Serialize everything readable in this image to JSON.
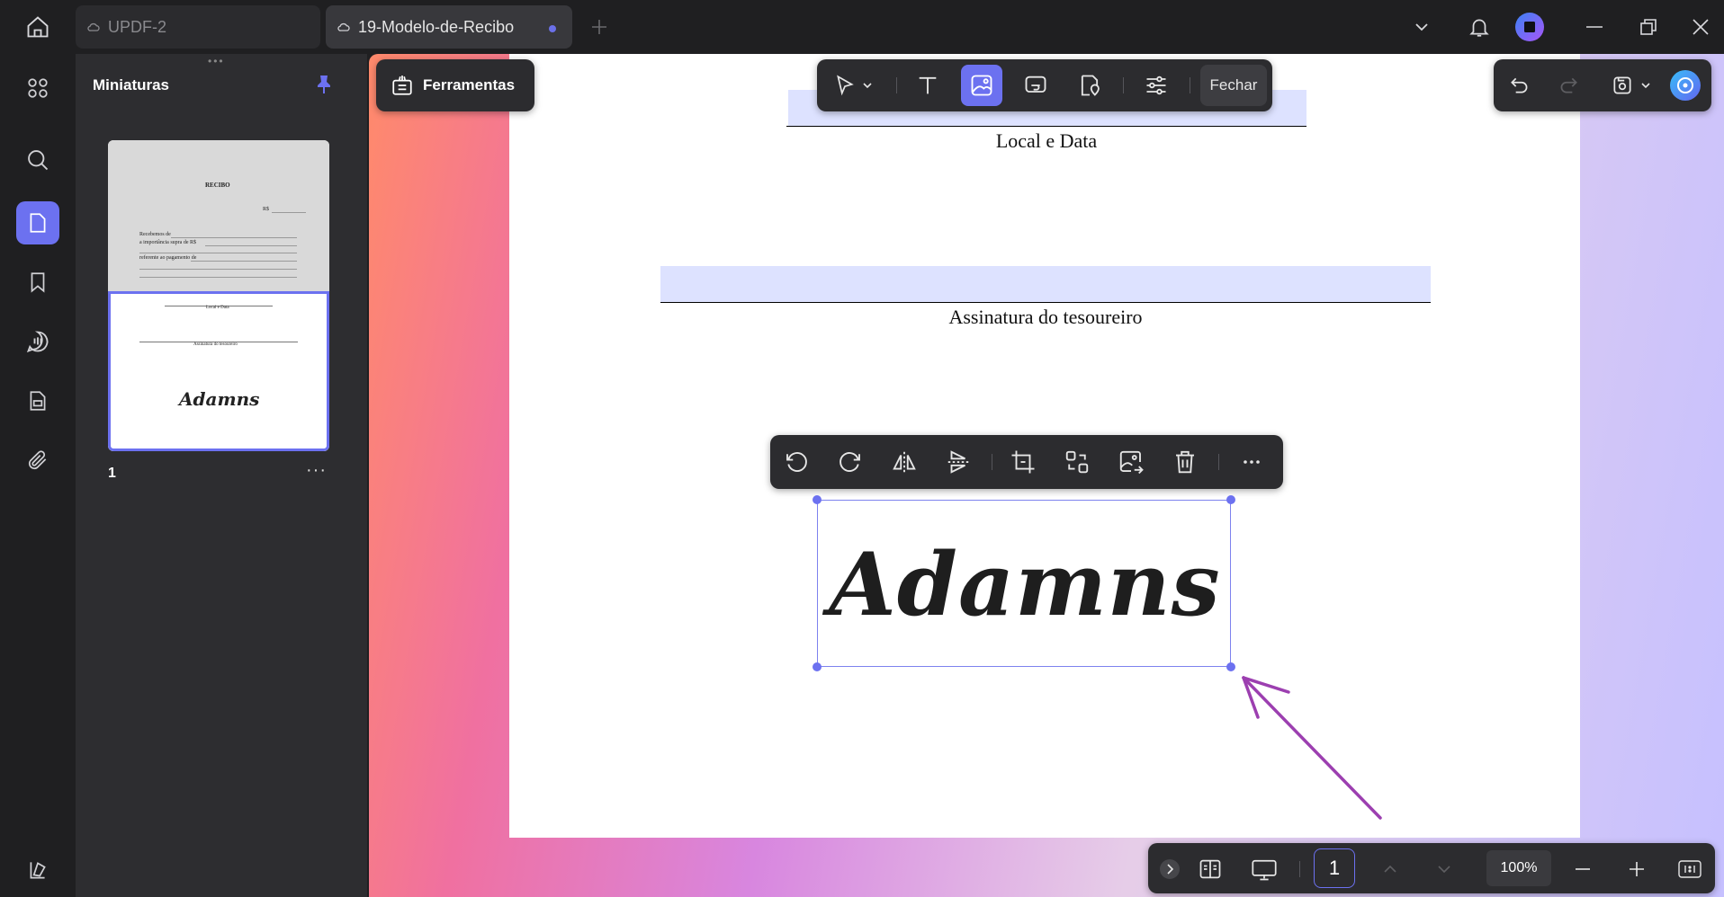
{
  "tabs": [
    {
      "label": "UPDF-2"
    },
    {
      "label": "19-Modelo-de-Recibo"
    }
  ],
  "sidebar": {
    "title": "Miniaturas",
    "page_number": "1",
    "thumb": {
      "title": "RECIBO",
      "rs": "R$",
      "line1": "Recebemos de",
      "line2": "a importância supra de R$",
      "line3": "referente ao pagamento de",
      "local_data": "Local e Data",
      "assinatura": "Assinatura do tesoureiro",
      "signature": "Adamns"
    }
  },
  "toolbar": {
    "ferramentas_label": "Ferramentas",
    "fechar_label": "Fechar"
  },
  "document": {
    "local_data": "Local e Data",
    "assinatura": "Assinatura do tesoureiro",
    "signature": "Adamns"
  },
  "bottom": {
    "page_input": "1",
    "zoom": "100%"
  },
  "colors": {
    "accent": "#6c71f0",
    "annotation_arrow": "#9c3fb0",
    "field_fill": "#dde2ff"
  }
}
